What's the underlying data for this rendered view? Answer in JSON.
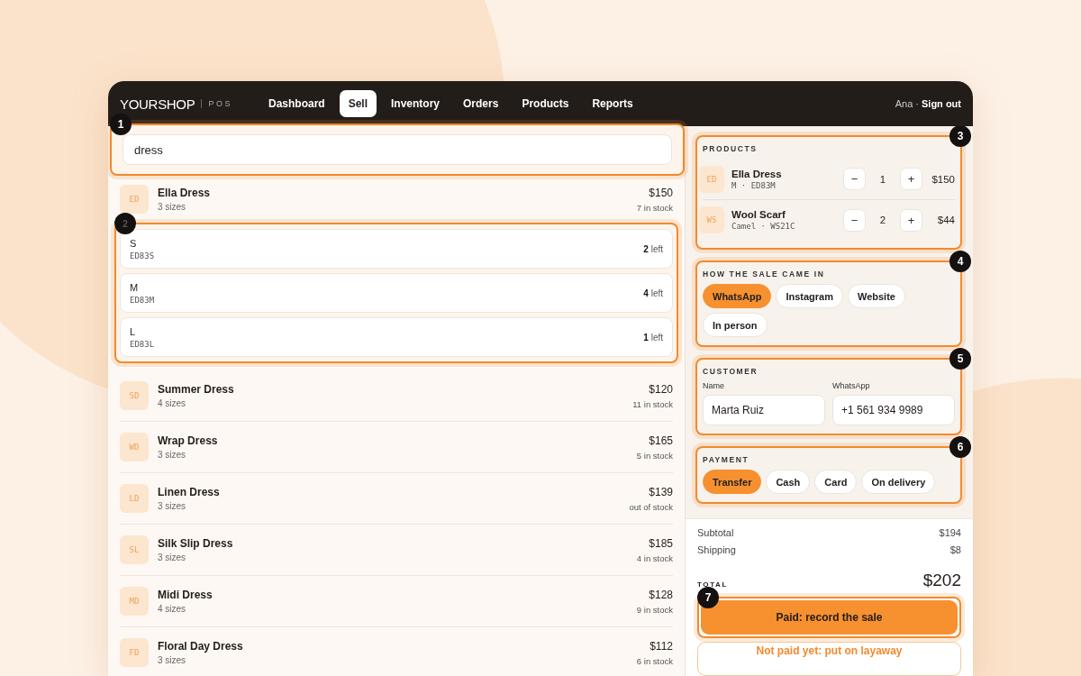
{
  "nav": {
    "brand": "YOURSHOP",
    "brand_suffix": "POS",
    "tabs": [
      {
        "label": "Dashboard",
        "selected": false
      },
      {
        "label": "Sell",
        "selected": true
      },
      {
        "label": "Inventory",
        "selected": false
      },
      {
        "label": "Orders",
        "selected": false
      },
      {
        "label": "Products",
        "selected": false
      },
      {
        "label": "Reports",
        "selected": false
      }
    ],
    "user": "Ana ·",
    "sign_out": "Sign out"
  },
  "search": {
    "value": "dress",
    "callout": "1"
  },
  "results": [
    {
      "initials": "ED",
      "name": "Ella Dress",
      "sizes": "3 sizes",
      "price": "$150",
      "stock": "7 in stock",
      "expanded": true,
      "callout": "2",
      "variants": [
        {
          "size": "S",
          "sku": "ED83S",
          "left": "**2** left"
        },
        {
          "size": "M",
          "sku": "ED83M",
          "left": "**4** left"
        },
        {
          "size": "L",
          "sku": "ED83L",
          "left": "**1** left"
        }
      ]
    },
    {
      "initials": "SD",
      "name": "Summer Dress",
      "sizes": "4 sizes",
      "price": "$120",
      "stock": "11 in stock",
      "expanded": false
    },
    {
      "initials": "WD",
      "name": "Wrap Dress",
      "sizes": "3 sizes",
      "price": "$165",
      "stock": "5 in stock",
      "expanded": false
    },
    {
      "initials": "LD",
      "name": "Linen Dress",
      "sizes": "3 sizes",
      "price": "$139",
      "stock": "out of stock",
      "expanded": false
    },
    {
      "initials": "SL",
      "name": "Silk Slip Dress",
      "sizes": "3 sizes",
      "price": "$185",
      "stock": "4 in stock",
      "expanded": false
    },
    {
      "initials": "MD",
      "name": "Midi Dress",
      "sizes": "4 sizes",
      "price": "$128",
      "stock": "9 in stock",
      "expanded": false
    },
    {
      "initials": "FD",
      "name": "Floral Day Dress",
      "sizes": "3 sizes",
      "price": "$112",
      "stock": "6 in stock",
      "expanded": false
    }
  ],
  "cart": {
    "title": "PRODUCTS",
    "callout": "3",
    "items": [
      {
        "initials": "ED",
        "name": "Ella Dress",
        "detail": "M · ED83M",
        "minus": "−",
        "qty": "1",
        "plus": "+",
        "price": "$150"
      },
      {
        "initials": "WS",
        "name": "Wool Scarf",
        "detail": "Camel · WS21C",
        "minus": "−",
        "qty": "2",
        "plus": "+",
        "price": "$44"
      }
    ]
  },
  "channel": {
    "title": "HOW THE SALE CAME IN",
    "callout": "4",
    "options": [
      {
        "label": "WhatsApp",
        "selected": true
      },
      {
        "label": "Instagram",
        "selected": false
      },
      {
        "label": "Website",
        "selected": false
      },
      {
        "label": "In person",
        "selected": false
      }
    ]
  },
  "customer": {
    "title": "CUSTOMER",
    "callout": "5",
    "fields": [
      {
        "label": "Name",
        "value": "Marta Ruiz"
      },
      {
        "label": "WhatsApp",
        "value": "+1 561 934 9989"
      }
    ]
  },
  "payment": {
    "title": "PAYMENT",
    "callout": "6",
    "options": [
      {
        "label": "Transfer",
        "selected": true
      },
      {
        "label": "Cash",
        "selected": false
      },
      {
        "label": "Card",
        "selected": false
      },
      {
        "label": "On delivery",
        "selected": false
      }
    ]
  },
  "summary": {
    "rows": [
      {
        "label": "Subtotal",
        "value": "$194"
      },
      {
        "label": "Shipping",
        "value": "$8"
      }
    ],
    "total_label": "TOTAL",
    "total": "$202"
  },
  "actions": [
    {
      "kind": "primary",
      "label": "Paid: record the sale",
      "callout": "7"
    },
    {
      "kind": "secondary",
      "label": "Not paid yet: put on layaway"
    }
  ]
}
